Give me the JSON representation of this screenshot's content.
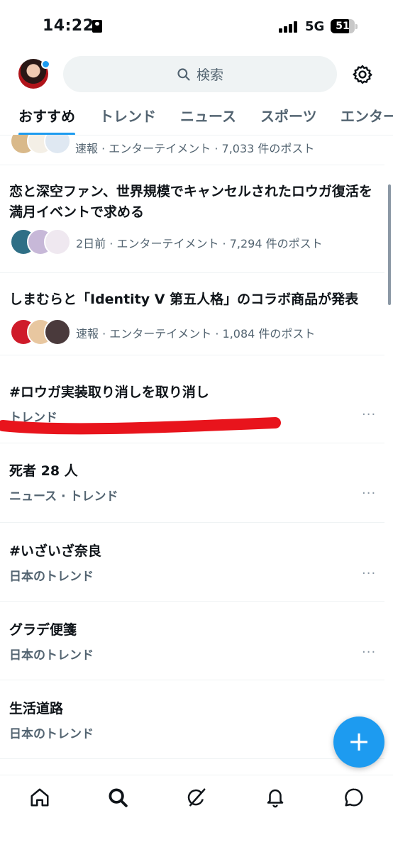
{
  "status_bar": {
    "time": "14:22",
    "network": "5G",
    "battery": "51"
  },
  "header": {
    "search_placeholder": "検索"
  },
  "tabs": [
    {
      "label": "おすすめ",
      "active": true
    },
    {
      "label": "トレンド",
      "active": false
    },
    {
      "label": "ニュース",
      "active": false
    },
    {
      "label": "スポーツ",
      "active": false
    },
    {
      "label": "エンター",
      "active": false
    }
  ],
  "news": [
    {
      "meta": "速報 · エンターテイメント · 7,033 件のポスト"
    },
    {
      "title": "恋と深空ファン、世界規模でキャンセルされたロウガ復活を満月イベントで求める",
      "meta": "2日前 · エンターテイメント · 7,294 件のポスト"
    },
    {
      "title": "しまむらと「Identity V 第五人格」のコラボ商品が発表",
      "meta": "速報 · エンターテイメント · 1,084 件のポスト"
    }
  ],
  "trends": [
    {
      "title": "#ロウガ実装取り消しを取り消し",
      "subtitle": "トレンド"
    },
    {
      "title": "死者 28 人",
      "subtitle": "ニュース · トレンド"
    },
    {
      "title": "#いざいざ奈良",
      "subtitle": "日本のトレンド"
    },
    {
      "title": "グラデ便箋",
      "subtitle": "日本のトレンド"
    },
    {
      "title": "生活道路",
      "subtitle": "日本のトレンド"
    }
  ],
  "more_label": "···",
  "fab_label": "+",
  "colors": {
    "accent": "#1d9bf0",
    "secondary_text": "#536471",
    "annotation": "#e8141c"
  },
  "icons": [
    "home-icon",
    "search-icon",
    "grok-icon",
    "bell-icon",
    "message-icon",
    "gear-icon"
  ]
}
